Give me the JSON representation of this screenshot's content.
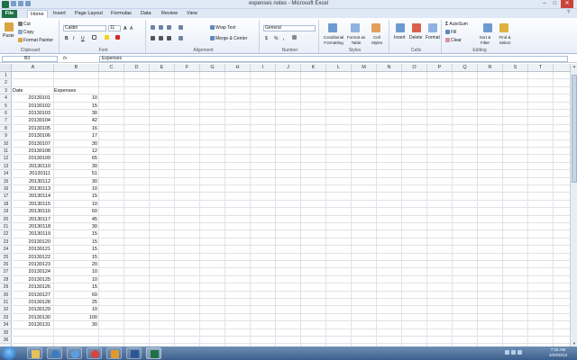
{
  "window": {
    "title": "expenses notes - Microsoft Excel",
    "minimize": "–",
    "maximize": "□",
    "close": "✕"
  },
  "tabs": [
    "File",
    "Home",
    "Insert",
    "Page Layout",
    "Formulas",
    "Data",
    "Review",
    "View"
  ],
  "ribbon": {
    "clipboard": {
      "label": "Clipboard",
      "paste": "Paste",
      "cut": "Cut",
      "copy": "Copy",
      "format_painter": "Format Painter"
    },
    "font": {
      "label": "Font",
      "name": "Calibri",
      "size": "11",
      "bold": "B",
      "italic": "I",
      "underline": "U",
      "grow": "A",
      "shrink": "A"
    },
    "alignment": {
      "label": "Alignment",
      "wrap_text": "Wrap Text",
      "merge": "Merge & Center"
    },
    "number": {
      "label": "Number",
      "format": "General",
      "currency": "$",
      "percent": "%",
      "comma": ","
    },
    "styles": {
      "label": "Styles",
      "conditional": "Conditional Formatting",
      "format_table": "Format as Table",
      "cell_styles": "Cell Styles"
    },
    "cells": {
      "label": "Cells",
      "insert": "Insert",
      "delete": "Delete",
      "format": "Format"
    },
    "editing": {
      "label": "Editing",
      "autosum": "AutoSum",
      "fill": "Fill",
      "clear": "Clear",
      "sort": "Sort & Filter",
      "find": "Find & Select"
    }
  },
  "formula_bar": {
    "name_box": "B3",
    "fx": "fx",
    "value": "Expenses"
  },
  "columns": [
    "A",
    "B",
    "C",
    "D",
    "E",
    "F",
    "G",
    "H",
    "I",
    "J",
    "K",
    "L",
    "M",
    "N",
    "O",
    "P",
    "Q",
    "R",
    "S",
    "T"
  ],
  "rows": [
    "1",
    "2",
    "3",
    "4",
    "5",
    "6",
    "7",
    "8",
    "9",
    "10",
    "11",
    "12",
    "13",
    "14",
    "15",
    "16",
    "17",
    "18",
    "19",
    "20",
    "21",
    "22",
    "23",
    "24",
    "25",
    "26",
    "27",
    "28",
    "29",
    "30",
    "31",
    "32",
    "33",
    "34",
    "35",
    "36"
  ],
  "sheet": {
    "header_date": "Date",
    "header_expenses": "Expenses",
    "data": [
      [
        "20130101",
        "10"
      ],
      [
        "20130102",
        "15"
      ],
      [
        "20130103",
        "30"
      ],
      [
        "20130104",
        "42"
      ],
      [
        "20130105",
        "16"
      ],
      [
        "20130106",
        "17"
      ],
      [
        "20130107",
        "30"
      ],
      [
        "20130108",
        "12"
      ],
      [
        "20130109",
        "65"
      ],
      [
        "20130110",
        "30"
      ],
      [
        "20130111",
        "51"
      ],
      [
        "20130112",
        "30"
      ],
      [
        "20130113",
        "10"
      ],
      [
        "20130114",
        "15"
      ],
      [
        "20130115",
        "10"
      ],
      [
        "20130116",
        "60"
      ],
      [
        "20130117",
        "45"
      ],
      [
        "20130118",
        "30"
      ],
      [
        "20130119",
        "15"
      ],
      [
        "20130120",
        "15"
      ],
      [
        "20130121",
        "15"
      ],
      [
        "20130122",
        "15"
      ],
      [
        "20130123",
        "20"
      ],
      [
        "20130124",
        "10"
      ],
      [
        "20130125",
        "10"
      ],
      [
        "20130126",
        "15"
      ],
      [
        "20130127",
        "60"
      ],
      [
        "20130128",
        "25"
      ],
      [
        "20130129",
        "10"
      ],
      [
        "20130130",
        "100"
      ],
      [
        "20130131",
        "30"
      ]
    ]
  },
  "taskbar": {
    "time": "7:32 AM",
    "date": "3/20/2013"
  }
}
